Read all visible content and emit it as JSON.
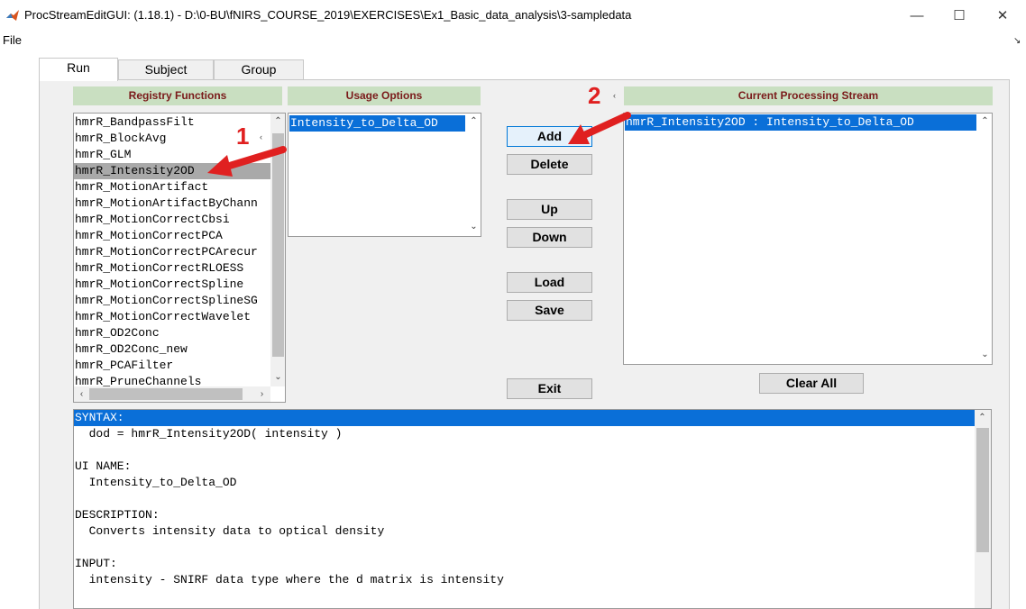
{
  "window": {
    "title": "ProcStreamEditGUI: (1.18.1) - D:\\0-BU\\fNIRS_COURSE_2019\\EXERCISES\\Ex1_Basic_data_analysis\\3-sampledata",
    "controls": {
      "minimize": "—",
      "maximize": "☐",
      "close": "✕"
    }
  },
  "menu": {
    "file": "File",
    "dock_icon": "↘"
  },
  "tabs": [
    {
      "label": "Run",
      "active": true
    },
    {
      "label": "Subject",
      "active": false
    },
    {
      "label": "Group",
      "active": false
    }
  ],
  "registry": {
    "header": "Registry Functions",
    "items": [
      "hmrR_BandpassFilt",
      "hmrR_BlockAvg",
      "hmrR_GLM",
      "hmrR_Intensity2OD",
      "hmrR_MotionArtifact",
      "hmrR_MotionArtifactByChann",
      "hmrR_MotionCorrectCbsi",
      "hmrR_MotionCorrectPCA",
      "hmrR_MotionCorrectPCArecur",
      "hmrR_MotionCorrectRLOESS",
      "hmrR_MotionCorrectSpline",
      "hmrR_MotionCorrectSplineSG",
      "hmrR_MotionCorrectWavelet",
      "hmrR_OD2Conc",
      "hmrR_OD2Conc_new",
      "hmrR_PCAFilter",
      "hmrR_PruneChannels"
    ],
    "selected_index": 3,
    "small_arrow": "‹"
  },
  "usage": {
    "header": "Usage Options",
    "items": [
      "Intensity_to_Delta_OD"
    ]
  },
  "current": {
    "header": "Current Processing Stream",
    "items": [
      "hmrR_Intensity2OD : Intensity_to_Delta_OD"
    ],
    "small_arrow": "‹"
  },
  "buttons": {
    "add": "Add",
    "delete": "Delete",
    "up": "Up",
    "down": "Down",
    "load": "Load",
    "save": "Save",
    "exit": "Exit",
    "clear_all": "Clear All"
  },
  "help": {
    "lines": [
      "SYNTAX:",
      "  dod = hmrR_Intensity2OD( intensity )",
      "",
      "UI NAME:",
      "  Intensity_to_Delta_OD",
      "",
      "DESCRIPTION:",
      "  Converts intensity data to optical density",
      "",
      "INPUT:",
      "  intensity - SNIRF data type where the d matrix is intensity"
    ],
    "selected_index": 0
  },
  "annotations": {
    "step1": "1",
    "step2": "2"
  },
  "colors": {
    "selection_blue": "#0a6fd8",
    "selection_gray": "#a9a9a9",
    "header_green": "#c9dfc1",
    "header_text": "#7a1a1a",
    "annotation_red": "#e02020"
  }
}
